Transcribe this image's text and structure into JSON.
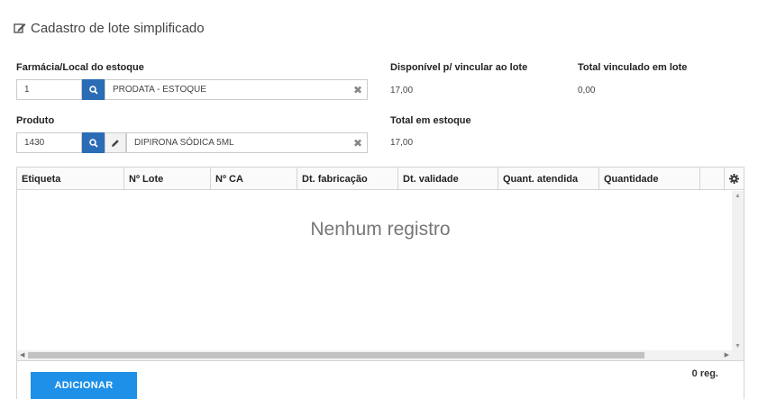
{
  "header": {
    "title": "Cadastro de lote simplificado",
    "icon": "edit-icon"
  },
  "location": {
    "label": "Farmácia/Local do estoque",
    "code": "1",
    "name": "PRODATA - ESTOQUE"
  },
  "available": {
    "label": "Disponível p/ vincular ao lote",
    "value": "17,00"
  },
  "linked": {
    "label": "Total vinculado em lote",
    "value": "0,00"
  },
  "product": {
    "label": "Produto",
    "code": "1430",
    "name": "DIPIRONA SÓDICA 5ML"
  },
  "stock": {
    "label": "Total em estoque",
    "value": "17,00"
  },
  "grid": {
    "columns": [
      "Etiqueta",
      "Nº Lote",
      "Nº CA",
      "Dt. fabricação",
      "Dt. validade",
      "Quant. atendida",
      "Quantidade"
    ],
    "empty_message": "Nenhum registro"
  },
  "footer": {
    "add_label": "ADICIONAR",
    "count": "0 reg."
  },
  "colors": {
    "primary": "#2a6cb5",
    "add_button": "#1e90e8"
  }
}
